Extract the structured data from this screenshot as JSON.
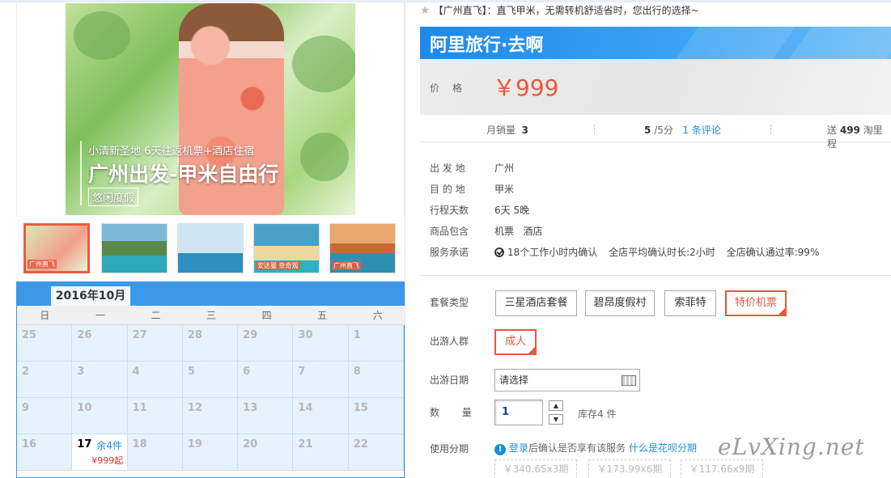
{
  "gallery": {
    "caption_small": "小清新圣地 6天往返机票+酒店住宿",
    "caption_big": "广州出发-甲米自由行",
    "caption_tag": "悠闲度假",
    "thumbs": [
      {
        "label": "广州直飞"
      },
      {
        "label": ""
      },
      {
        "label": ""
      },
      {
        "label": "安达曼 奈奇观"
      },
      {
        "label": "广州直飞"
      }
    ]
  },
  "calendar": {
    "month": "2016年10月",
    "weekdays": [
      "日",
      "一",
      "二",
      "三",
      "四",
      "五",
      "六"
    ],
    "rows": [
      [
        {
          "d": "25"
        },
        {
          "d": "26"
        },
        {
          "d": "27"
        },
        {
          "d": "28"
        },
        {
          "d": "29"
        },
        {
          "d": "30"
        },
        {
          "d": "1"
        }
      ],
      [
        {
          "d": "2"
        },
        {
          "d": "3"
        },
        {
          "d": "4"
        },
        {
          "d": "5"
        },
        {
          "d": "6"
        },
        {
          "d": "7"
        },
        {
          "d": "8"
        }
      ],
      [
        {
          "d": "9"
        },
        {
          "d": "10"
        },
        {
          "d": "11"
        },
        {
          "d": "12"
        },
        {
          "d": "13"
        },
        {
          "d": "14"
        },
        {
          "d": "15"
        }
      ],
      [
        {
          "d": "16"
        },
        {
          "d": "17",
          "stock": "余4件",
          "price": "¥999起"
        },
        {
          "d": "18"
        },
        {
          "d": "19"
        },
        {
          "d": "20"
        },
        {
          "d": "21"
        },
        {
          "d": "22"
        }
      ]
    ]
  },
  "product": {
    "title": "【广州直飞】：直飞甲米，无需转机舒适省时，您出行的选择~",
    "brand": "阿里旅行·去啊",
    "price_label": "价格",
    "price": "￥999"
  },
  "stats": {
    "monthly_label": "月销量",
    "monthly_value": "3",
    "rating_value": "5",
    "rating_suffix": "/5分",
    "reviews_link": "1 条评论",
    "points_prefix": "送",
    "points_value": "499",
    "points_suffix": "淘里程"
  },
  "details": [
    {
      "label": "出 发 地",
      "value": "广州"
    },
    {
      "label": "目 的 地",
      "value": "甲米"
    },
    {
      "label": "行程天数",
      "value": "6天 5晚"
    },
    {
      "label": "商品包含",
      "value": "机票   酒店"
    }
  ],
  "service": {
    "label": "服务承诺",
    "items": [
      "18个工作小时内确认",
      "全店平均确认时长:2小时",
      "全店确认通过率:99%"
    ]
  },
  "package": {
    "label": "套餐类型",
    "options": [
      "三星酒店套餐",
      "碧昂度假村",
      "索菲特",
      "特价机票"
    ],
    "selected": 3
  },
  "travelers": {
    "label": "出游人群",
    "options": [
      "成人"
    ]
  },
  "date": {
    "label": "出游日期",
    "placeholder": "请选择"
  },
  "quantity": {
    "label": "数 量",
    "value": "1",
    "stock_note": "库存4 件"
  },
  "installment": {
    "label": "使用分期",
    "login_link": "登录",
    "text": "后确认是否享有该服务",
    "what_link": "什么是花呗分期",
    "options": [
      {
        "amount": "￥340.65",
        "periods": "x3期"
      },
      {
        "amount": "￥173.99",
        "periods": "x6期"
      },
      {
        "amount": "￥117.66",
        "periods": "x9期"
      }
    ]
  },
  "watermark": "eLvXing.net"
}
